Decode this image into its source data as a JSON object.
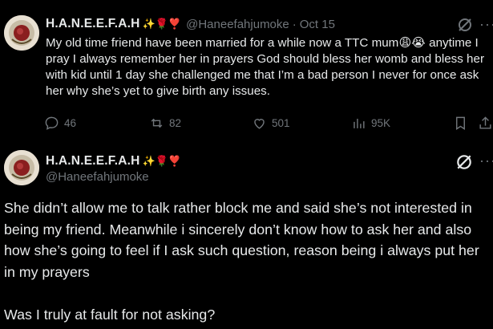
{
  "post1": {
    "display_name": "H.A.N.E.E.F.A.H",
    "name_emojis": "✨🌹❣️",
    "handle": "@Haneefahjumoke",
    "separator": "·",
    "date": "Oct 15",
    "more_label": "···",
    "text": "My old time friend have been married for a while now a TTC mum😩😭 anytime I pray I always remember her in prayers God should bless her womb and bless her with kid until 1 day she challenged me that I’m a bad person I never for once ask her why she’s yet to give birth any issues.",
    "replies": "46",
    "reposts": "82",
    "likes": "501",
    "views": "95K"
  },
  "post2": {
    "display_name": "H.A.N.E.E.F.A.H",
    "name_emojis": "✨🌹❣️",
    "handle": "@Haneefahjumoke",
    "more_label": "···",
    "paragraph1": "She didn’t allow me to talk rather block me and said she’s not interested in being my friend. Meanwhile i sincerely don’t know how to ask her and also how she’s going to feel if I ask such question, reason being i always put her in my prayers",
    "paragraph2": "Was I truly at fault for not asking?"
  }
}
